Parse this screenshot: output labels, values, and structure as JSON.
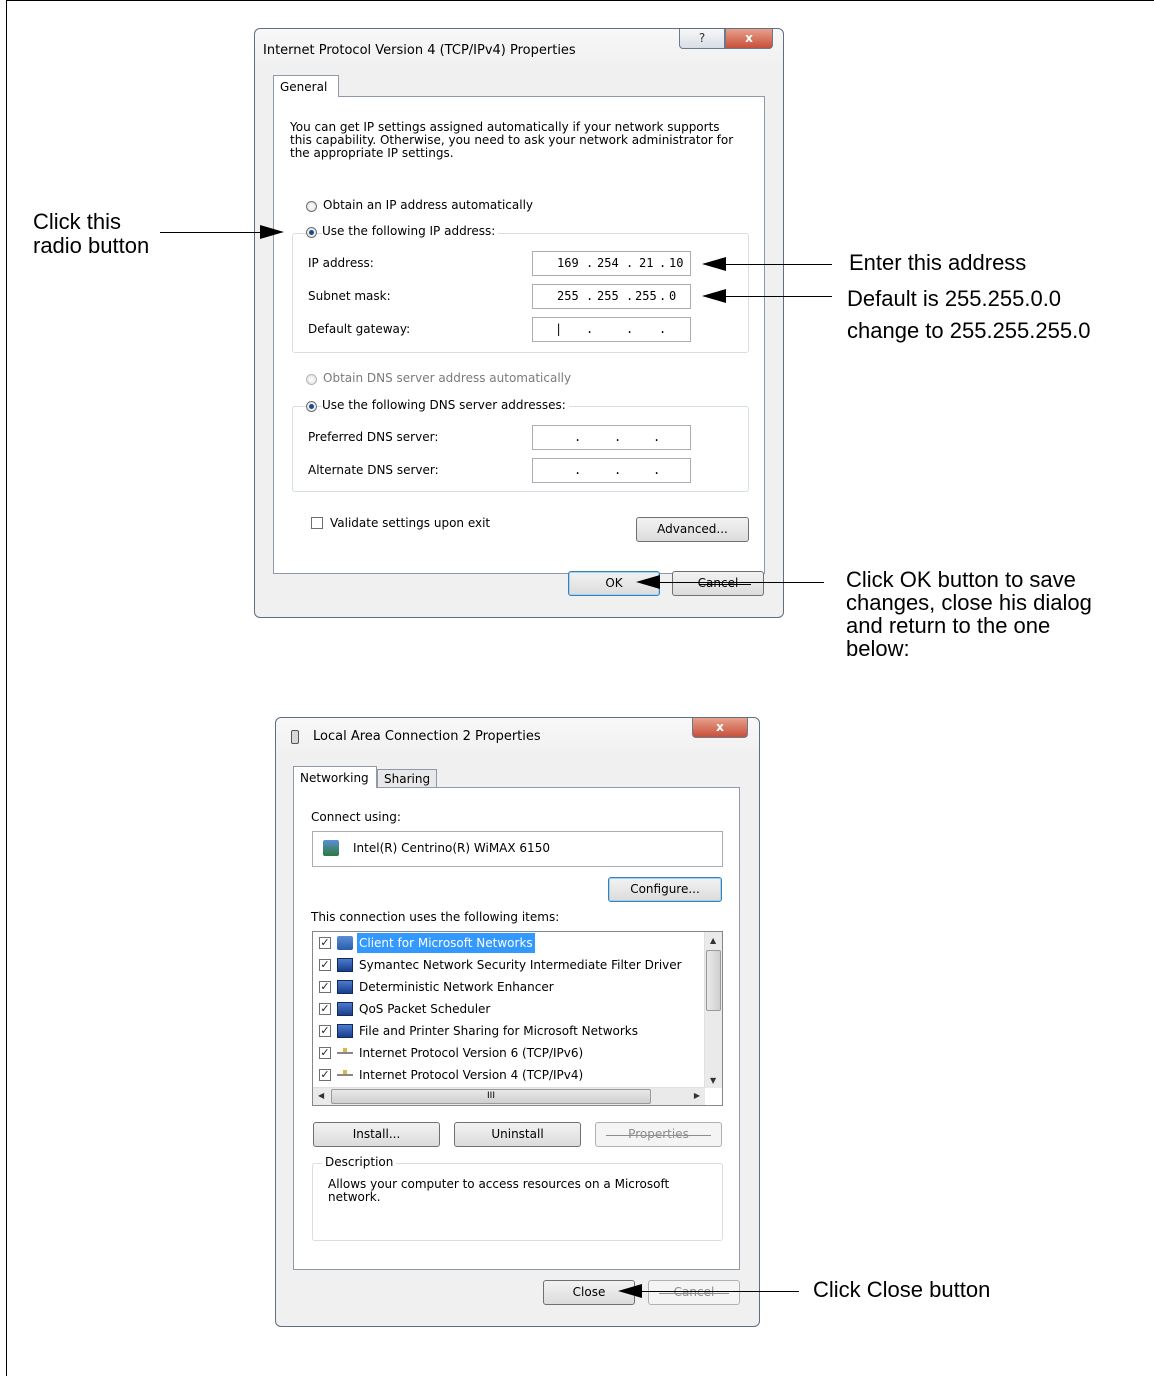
{
  "annotations": {
    "radio_note_line1": "Click this",
    "radio_note_line2": "radio button",
    "ip_note": "Enter this address",
    "subnet_note_line1": "Default is 255.255.0.0",
    "subnet_note_line2": "change to 255.255.255.0",
    "ok_note_line1": "Click OK button to save",
    "ok_note_line2": "changes, close his dialog",
    "ok_note_line3": "and return to the one",
    "ok_note_line4": "below:",
    "close_note": "Click Close button"
  },
  "ipv4_dialog": {
    "title": "Internet Protocol Version 4 (TCP/IPv4) Properties",
    "help_glyph": "?",
    "close_glyph": "x",
    "tab_general": "General",
    "intro": "You can get IP settings assigned automatically if your network supports this capability. Otherwise, you need to ask your network administrator for the appropriate IP settings.",
    "radio_auto_ip": "Obtain an IP address automatically",
    "radio_manual_ip": "Use the following IP address:",
    "ip_label": "IP address:",
    "ip_octets": [
      "169",
      "254",
      "21",
      "10"
    ],
    "subnet_label": "Subnet mask:",
    "subnet_octets": [
      "255",
      "255",
      "255",
      "0"
    ],
    "gateway_label": "Default gateway:",
    "radio_auto_dns": "Obtain DNS server address automatically",
    "radio_manual_dns": "Use the following DNS server addresses:",
    "preferred_dns_label": "Preferred DNS server:",
    "alternate_dns_label": "Alternate DNS server:",
    "validate_label": "Validate settings upon exit",
    "advanced_button": "Advanced...",
    "ok_button": "OK",
    "cancel_button": "Cancel"
  },
  "lan_dialog": {
    "title": "Local Area Connection 2 Properties",
    "close_glyph": "x",
    "tab_networking": "Networking",
    "tab_sharing": "Sharing",
    "connect_using_label": "Connect using:",
    "adapter_name": "Intel(R) Centrino(R) WiMAX 6150",
    "configure_button": "Configure...",
    "items_label": "This connection uses the following items:",
    "items": [
      {
        "label": "Client for Microsoft Networks",
        "icon": "network-client-icon",
        "checked": true
      },
      {
        "label": "Symantec Network Security Intermediate Filter Driver",
        "icon": "computer-icon",
        "checked": true
      },
      {
        "label": "Deterministic Network Enhancer",
        "icon": "computer-icon",
        "checked": true
      },
      {
        "label": "QoS Packet Scheduler",
        "icon": "computer-icon",
        "checked": true
      },
      {
        "label": "File and Printer Sharing for Microsoft Networks",
        "icon": "computer-icon",
        "checked": true
      },
      {
        "label": "Internet Protocol Version 6 (TCP/IPv6)",
        "icon": "protocol-icon",
        "checked": true
      },
      {
        "label": "Internet Protocol Version 4 (TCP/IPv4)",
        "icon": "protocol-icon",
        "checked": true
      }
    ],
    "hscroll_grip": "III",
    "install_button": "Install...",
    "uninstall_button": "Uninstall",
    "properties_button": "Properties",
    "description_legend": "Description",
    "description_text": "Allows your computer to access resources on a Microsoft network.",
    "close_button": "Close",
    "cancel_button": "Cancel"
  }
}
